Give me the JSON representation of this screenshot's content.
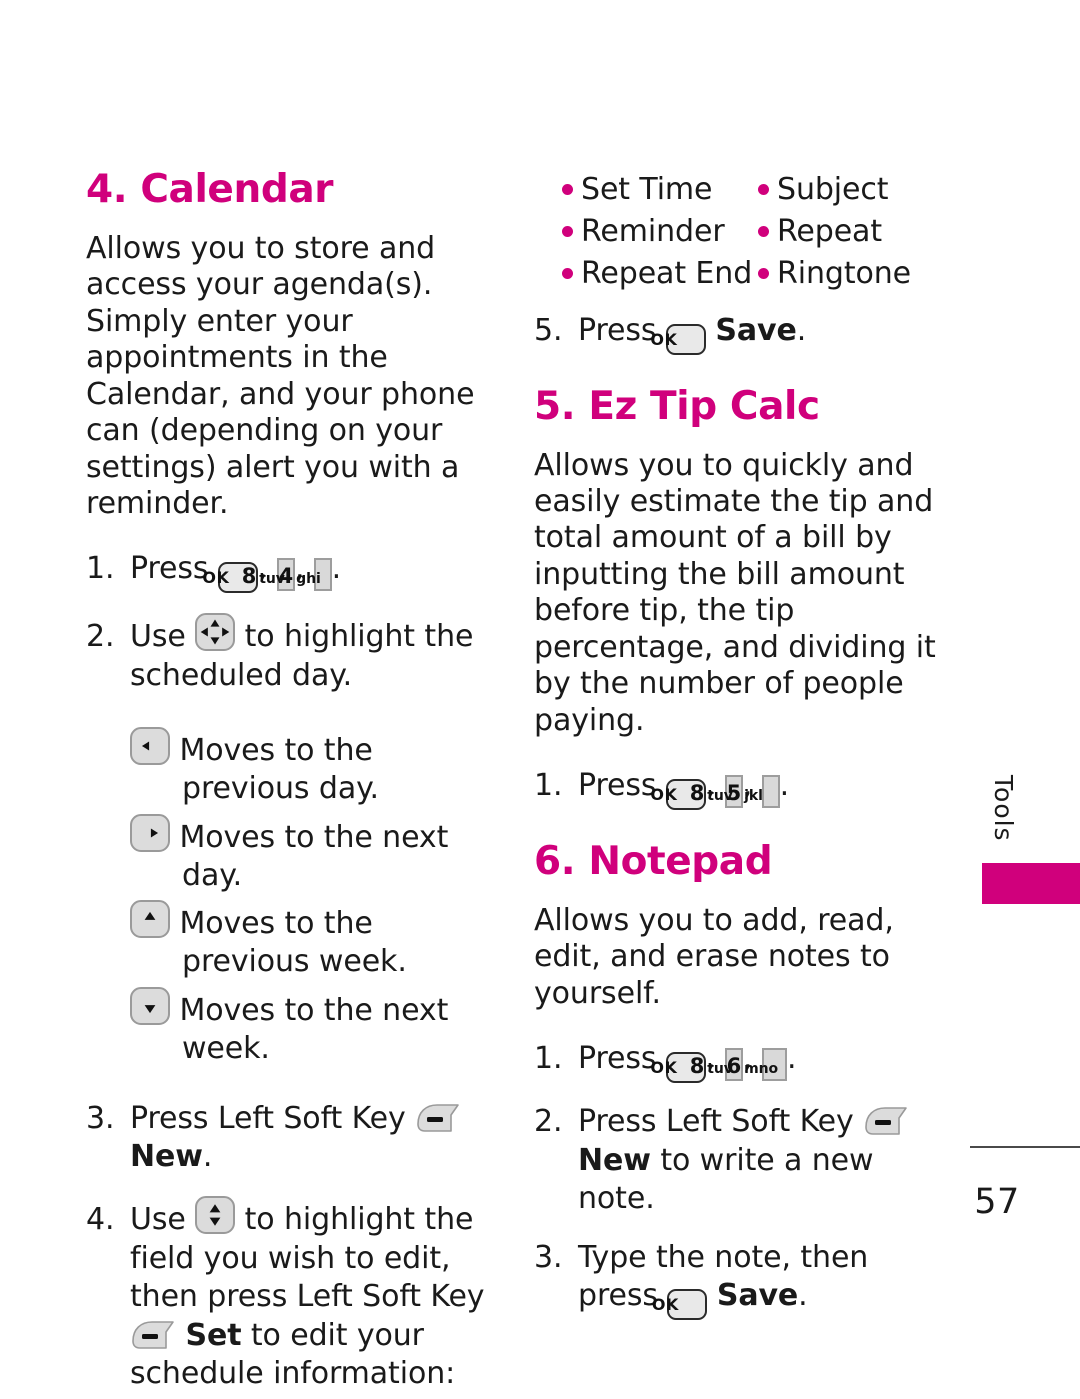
{
  "page": {
    "number": "57",
    "tab_label": "Tools",
    "accent_color": "#d0007c"
  },
  "sections": {
    "calendar": {
      "heading": "4. Calendar",
      "description": "Allows you to store and access your agenda(s). Simply enter your appointments in the Calendar, and your phone can (depending on your settings) alert you with a reminder.",
      "steps": {
        "s1_num": "1.",
        "s1_press": "Press",
        "s1_comma1": ",",
        "s1_comma2": ",",
        "s1_period": ".",
        "s2_num": "2.",
        "s2_use": "Use",
        "s2_text": "to highlight the scheduled day.",
        "s3_num": "3.",
        "s3_text": "Press Left Soft Key",
        "s3_bold": "New",
        "s3_period": ".",
        "s4_num": "4.",
        "s4_use": "Use",
        "s4_text_a": "to highlight the field you wish to edit, then press Left Soft Key",
        "s4_bold": "Set",
        "s4_text_b": "to edit your schedule information:"
      },
      "nav_help": [
        {
          "icon": "arrow-left-key-icon",
          "text": "Moves to the previous day."
        },
        {
          "icon": "arrow-right-key-icon",
          "text": "Moves to the next day."
        },
        {
          "icon": "arrow-up-key-icon",
          "text": "Moves to the previous week."
        },
        {
          "icon": "arrow-down-key-icon",
          "text": "Moves to the next week."
        }
      ],
      "fields": [
        "Set Time",
        "Subject",
        "Reminder",
        "Repeat",
        "Repeat End",
        "Ringtone"
      ],
      "save_step": {
        "num": "5.",
        "press": "Press",
        "bold": "Save",
        "period": "."
      }
    },
    "ez_tip_calc": {
      "heading": "5. Ez Tip Calc",
      "description": "Allows you to quickly and easily estimate the tip and total amount of a bill by inputting the bill amount before tip, the tip percentage, and dividing it by the number of people paying.",
      "step1": {
        "num": "1.",
        "press": "Press",
        "comma1": ",",
        "comma2": ",",
        "period": "."
      }
    },
    "notepad": {
      "heading": "6. Notepad",
      "description": "Allows you to add, read, edit, and erase notes to yourself.",
      "steps": {
        "s1_num": "1.",
        "s1_press": "Press",
        "s1_comma1": ",",
        "s1_comma2": ",",
        "s1_period": ".",
        "s2_num": "2.",
        "s2_text": "Press Left Soft Key",
        "s2_bold": "New",
        "s2_text_b": "to write a new note.",
        "s3_num": "3.",
        "s3_text": "Type the note, then press",
        "s3_bold": "Save",
        "s3_period": "."
      }
    }
  },
  "keys": {
    "ok": "OK",
    "k8_digit": "8",
    "k8_letters": "tuv",
    "k4_digit": "4",
    "k4_letters": "ghi",
    "k5_digit": "5",
    "k5_letters": "jkl",
    "k6_digit": "6",
    "k6_letters": "mno"
  }
}
